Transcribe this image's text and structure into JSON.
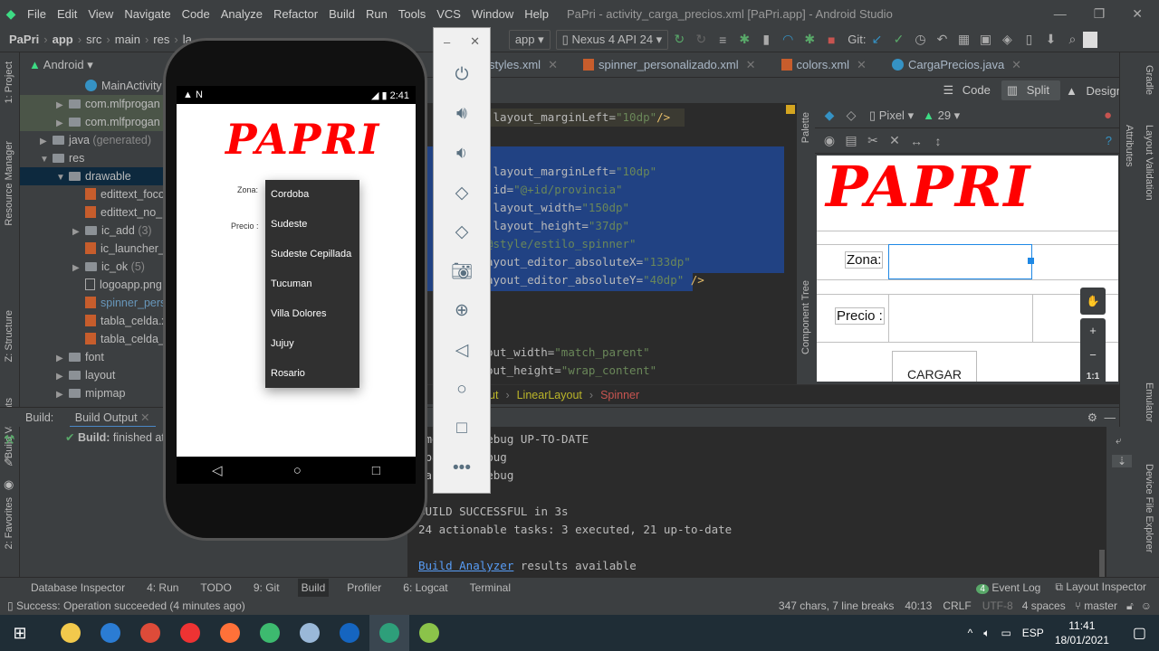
{
  "window": {
    "menu": [
      "File",
      "Edit",
      "View",
      "Navigate",
      "Code",
      "Analyze",
      "Refactor",
      "Build",
      "Run",
      "Tools",
      "VCS",
      "Window",
      "Help"
    ],
    "title": "PaPri - activity_carga_precios.xml [PaPri.app] - Android Studio"
  },
  "nav": {
    "breadcrumb": [
      "PaPri",
      "app",
      "src",
      "main",
      "res",
      "la"
    ],
    "run_config": "app",
    "device": "Nexus 4 API 24",
    "git_label": "Git:"
  },
  "left_strip": [
    "1: Project",
    "Resource Manager",
    "Z: Structure",
    "Build Variants",
    "2: Favorites"
  ],
  "project": {
    "view": "Android",
    "items": [
      {
        "label": "MainActivity",
        "kind": "class",
        "indent": 3
      },
      {
        "label": "com.mlfprogan",
        "kind": "folder",
        "indent": 2,
        "arrow": "▶",
        "hl": true
      },
      {
        "label": "com.mlfprogan",
        "kind": "folder",
        "indent": 2,
        "arrow": "▶",
        "hl": true
      },
      {
        "label": "java",
        "suffix": " (generated)",
        "kind": "folder",
        "indent": 1,
        "arrow": "▶"
      },
      {
        "label": "res",
        "kind": "folder",
        "indent": 1,
        "arrow": "▼"
      },
      {
        "label": "drawable",
        "kind": "folder",
        "indent": 2,
        "arrow": "▼",
        "sel": true
      },
      {
        "label": "edittext_foco",
        "kind": "xml",
        "indent": 3
      },
      {
        "label": "edittext_no_",
        "kind": "xml",
        "indent": 3
      },
      {
        "label": "ic_add",
        "suffix": " (3)",
        "kind": "folder",
        "indent": 3,
        "arrow": "▶"
      },
      {
        "label": "ic_launcher_",
        "kind": "xml",
        "indent": 3
      },
      {
        "label": "ic_ok",
        "suffix": " (5)",
        "kind": "folder",
        "indent": 3,
        "arrow": "▶"
      },
      {
        "label": "logoapp.png",
        "kind": "img",
        "indent": 3
      },
      {
        "label": "spinner_pers",
        "kind": "xml",
        "indent": 3,
        "blue": true
      },
      {
        "label": "tabla_celda.x",
        "kind": "xml",
        "indent": 3
      },
      {
        "label": "tabla_celda_",
        "kind": "xml",
        "indent": 3
      },
      {
        "label": "font",
        "kind": "folder",
        "indent": 2,
        "arrow": "▶"
      },
      {
        "label": "layout",
        "kind": "folder",
        "indent": 2,
        "arrow": "▶"
      },
      {
        "label": "mipmap",
        "kind": "folder",
        "indent": 2,
        "arrow": "▶"
      }
    ]
  },
  "tabs": [
    {
      "label": "styles.xml"
    },
    {
      "label": "spinner_personalizado.xml"
    },
    {
      "label": "colors.xml"
    },
    {
      "label": "CargaPrecios.java"
    }
  ],
  "view_modes": [
    "Code",
    "Split",
    "Design"
  ],
  "code": [
    {
      "a": ":layout_marginLeft=",
      "v": "\"10dp\"",
      "t": "/>",
      "row": 0
    },
    {
      "a": ":layout_marginLeft=",
      "v": "\"10dp\"",
      "t": "",
      "row": 3
    },
    {
      "a": ":id=",
      "v": "\"@+id/provincia\"",
      "t": "",
      "row": 4
    },
    {
      "a": ":layout_width=",
      "v": "\"150dp\"",
      "t": "",
      "row": 5
    },
    {
      "a": ":layout_height=",
      "v": "\"37dp\"",
      "t": "",
      "row": 6
    },
    {
      "a": "",
      "v": "@style/estilo_spinner\"",
      "t": "",
      "row": 7
    },
    {
      "a": "ayout_editor_absoluteX=",
      "v": "\"133dp\"",
      "t": "",
      "row": 8
    },
    {
      "a": "ayout_editor_absoluteY=",
      "v": "\"40dp\"",
      "t": " />",
      "row": 9
    },
    {
      "a": "out_width=",
      "v": "\"match_parent\"",
      "t": "",
      "row": 13
    },
    {
      "a": "out_height=",
      "v": "\"wrap_content\"",
      "t": "",
      "row": 14
    }
  ],
  "editor_breadcrumb": [
    "ut",
    "LinearLayout",
    "Spinner"
  ],
  "design": {
    "device": "Pixel",
    "api": "29",
    "logo": "PAPRI",
    "zona_label": "Zona:",
    "precio_label": "Precio :",
    "button": "CARGAR",
    "side_tabs": [
      "Palette",
      "Component Tree"
    ],
    "zoom": [
      "+",
      "−",
      "1:1"
    ]
  },
  "right_strip": [
    "Gradle",
    "Attributes",
    "Layout Validation",
    "Emulator",
    "Device File Explorer"
  ],
  "build": {
    "header": "Build:",
    "tab": "Build Output",
    "status_bold": "Build:",
    "status": " finished at",
    "lines": [
      ":mergeDexDebug UP-TO-DATE",
      ":packageDebug",
      ":assembleDebug",
      "",
      "BUILD SUCCESSFUL in 3s",
      "24 actionable tasks: 3 executed, 21 up-to-date",
      ""
    ],
    "analyzer_link": "Build Analyzer",
    "analyzer_rest": " results available"
  },
  "phone": {
    "time": "2:41",
    "logo": "PAPRI",
    "zona": "Zona:",
    "precio": "Precio :",
    "options": [
      "Cordoba",
      "Sudeste",
      "Sudeste Cepillada",
      "Tucuman",
      "Villa Dolores",
      "Jujuy",
      "Rosario"
    ]
  },
  "tool_tabs": [
    "Database Inspector",
    "4: Run",
    "TODO",
    "9: Git",
    "Build",
    "Profiler",
    "6: Logcat",
    "Terminal"
  ],
  "tool_tabs_right": {
    "event_count": "4",
    "event_log": "Event Log",
    "layout_inspector": "Layout Inspector"
  },
  "status": {
    "message": "Success: Operation succeeded (4 minutes ago)",
    "chars": "347 chars, 7 line breaks",
    "pos": "40:13",
    "eol": "CRLF",
    "enc": "UTF-8",
    "indent": "4 spaces",
    "branch": "master"
  },
  "taskbar": {
    "lang": "ESP",
    "time": "11:41",
    "date": "18/01/2021",
    "apps": [
      "#f2c94c",
      "#2b7cd3",
      "#dd4b39",
      "#e33",
      "#ff7139",
      "#3dba6f",
      "#9ab8d8",
      "#1565c0",
      "#2e9f7a",
      "#8bc34a"
    ]
  },
  "colors": {
    "accent": "#3592c4",
    "selection": "#214283",
    "logo_red": "#ff0000",
    "string": "#6a8759"
  }
}
